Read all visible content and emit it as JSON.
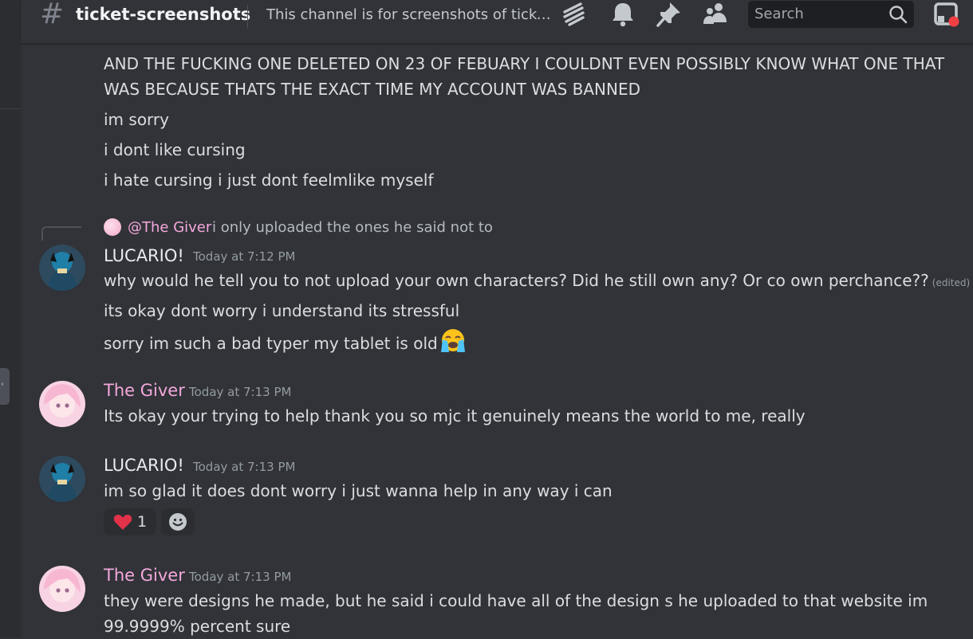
{
  "header": {
    "channel_name": "ticket-screenshots",
    "topic": "This channel is for screenshots of ticke...",
    "search_placeholder": "Search"
  },
  "top_message_lines": [
    "AND THE FUCKING ONE DELETED ON 23 OF FEBUARY I COULDNT EVEN POSSIBLY KNOW WHAT ONE THAT",
    "WAS BECAUSE THATS THE EXACT TIME MY ACCOUNT WAS BANNED",
    "im sorry",
    "i dont like cursing",
    "i hate cursing i just dont feelmlike myself"
  ],
  "messages": [
    {
      "author": "LUCARIO!",
      "timestamp": "Today at 7:12 PM",
      "reply_to": "@The Giver",
      "reply_text": "i only uploaded the ones he said not to",
      "lines": [
        "why would he tell you to not upload your own characters? Did he still own any? Or co own perchance??",
        "its okay dont worry i understand its stressful",
        "sorry im such a bad typer my tablet is old"
      ],
      "edited_label": "(edited)"
    },
    {
      "author": "The Giver",
      "timestamp": "Today at 7:13 PM",
      "lines": [
        "Its okay your trying to help thank you so mjc it genuinely means the world to me, really"
      ]
    },
    {
      "author": "LUCARIO!",
      "timestamp": "Today at 7:13 PM",
      "lines": [
        "im so glad it does dont worry i just wanna help in any way i can"
      ],
      "reaction_count": "1"
    },
    {
      "author": "The Giver",
      "timestamp": "Today at 7:13 PM",
      "lines": [
        "they were designs he made, but he said i could have all of the design s he uploaded to that website im",
        "99.9999% percent sure"
      ]
    }
  ],
  "colors": {
    "background": "#313338",
    "giver_name": "#f4a8dc",
    "lucario_name": "#eaeaf0",
    "reaction_heart": "#e2324a"
  },
  "icons": [
    "hash-icon",
    "threads-icon",
    "bell-icon",
    "pin-icon",
    "members-icon",
    "search-icon",
    "inbox-icon",
    "heart-emoji",
    "add-reaction-icon",
    "crying-emoji"
  ]
}
